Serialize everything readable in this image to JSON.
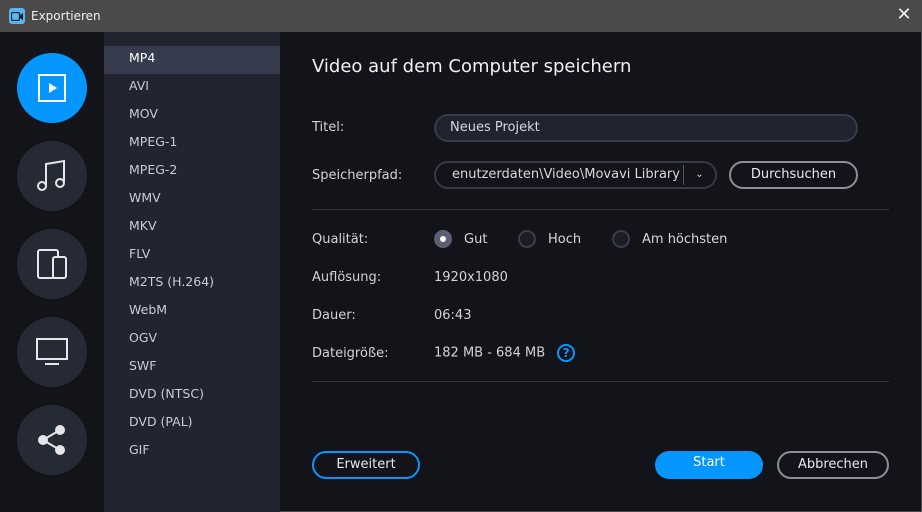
{
  "window": {
    "title": "Exportieren"
  },
  "sidebar": {
    "items": [
      {
        "name": "video"
      },
      {
        "name": "audio"
      },
      {
        "name": "devices"
      },
      {
        "name": "tv"
      },
      {
        "name": "share"
      }
    ]
  },
  "formats": [
    "MP4",
    "AVI",
    "MOV",
    "MPEG-1",
    "MPEG-2",
    "WMV",
    "MKV",
    "FLV",
    "M2TS (H.264)",
    "WebM",
    "OGV",
    "SWF",
    "DVD (NTSC)",
    "DVD (PAL)",
    "GIF"
  ],
  "main": {
    "heading": "Video auf dem Computer speichern",
    "title_label": "Titel:",
    "title_value": "Neues Projekt",
    "path_label": "Speicherpfad:",
    "path_value": "enutzerdaten\\Video\\Movavi Library",
    "browse": "Durchsuchen",
    "quality_label": "Qualität:",
    "quality_options": [
      "Gut",
      "Hoch",
      "Am höchsten"
    ],
    "quality_selected": "Gut",
    "resolution_label": "Auflösung:",
    "resolution": "1920x1080",
    "duration_label": "Dauer:",
    "duration": "06:43",
    "size_label": "Dateigröße:",
    "size": "182 MB - 684 MB",
    "advanced": "Erweitert",
    "start": "Start",
    "cancel": "Abbrechen"
  },
  "colors": {
    "accent": "#0597ff"
  }
}
